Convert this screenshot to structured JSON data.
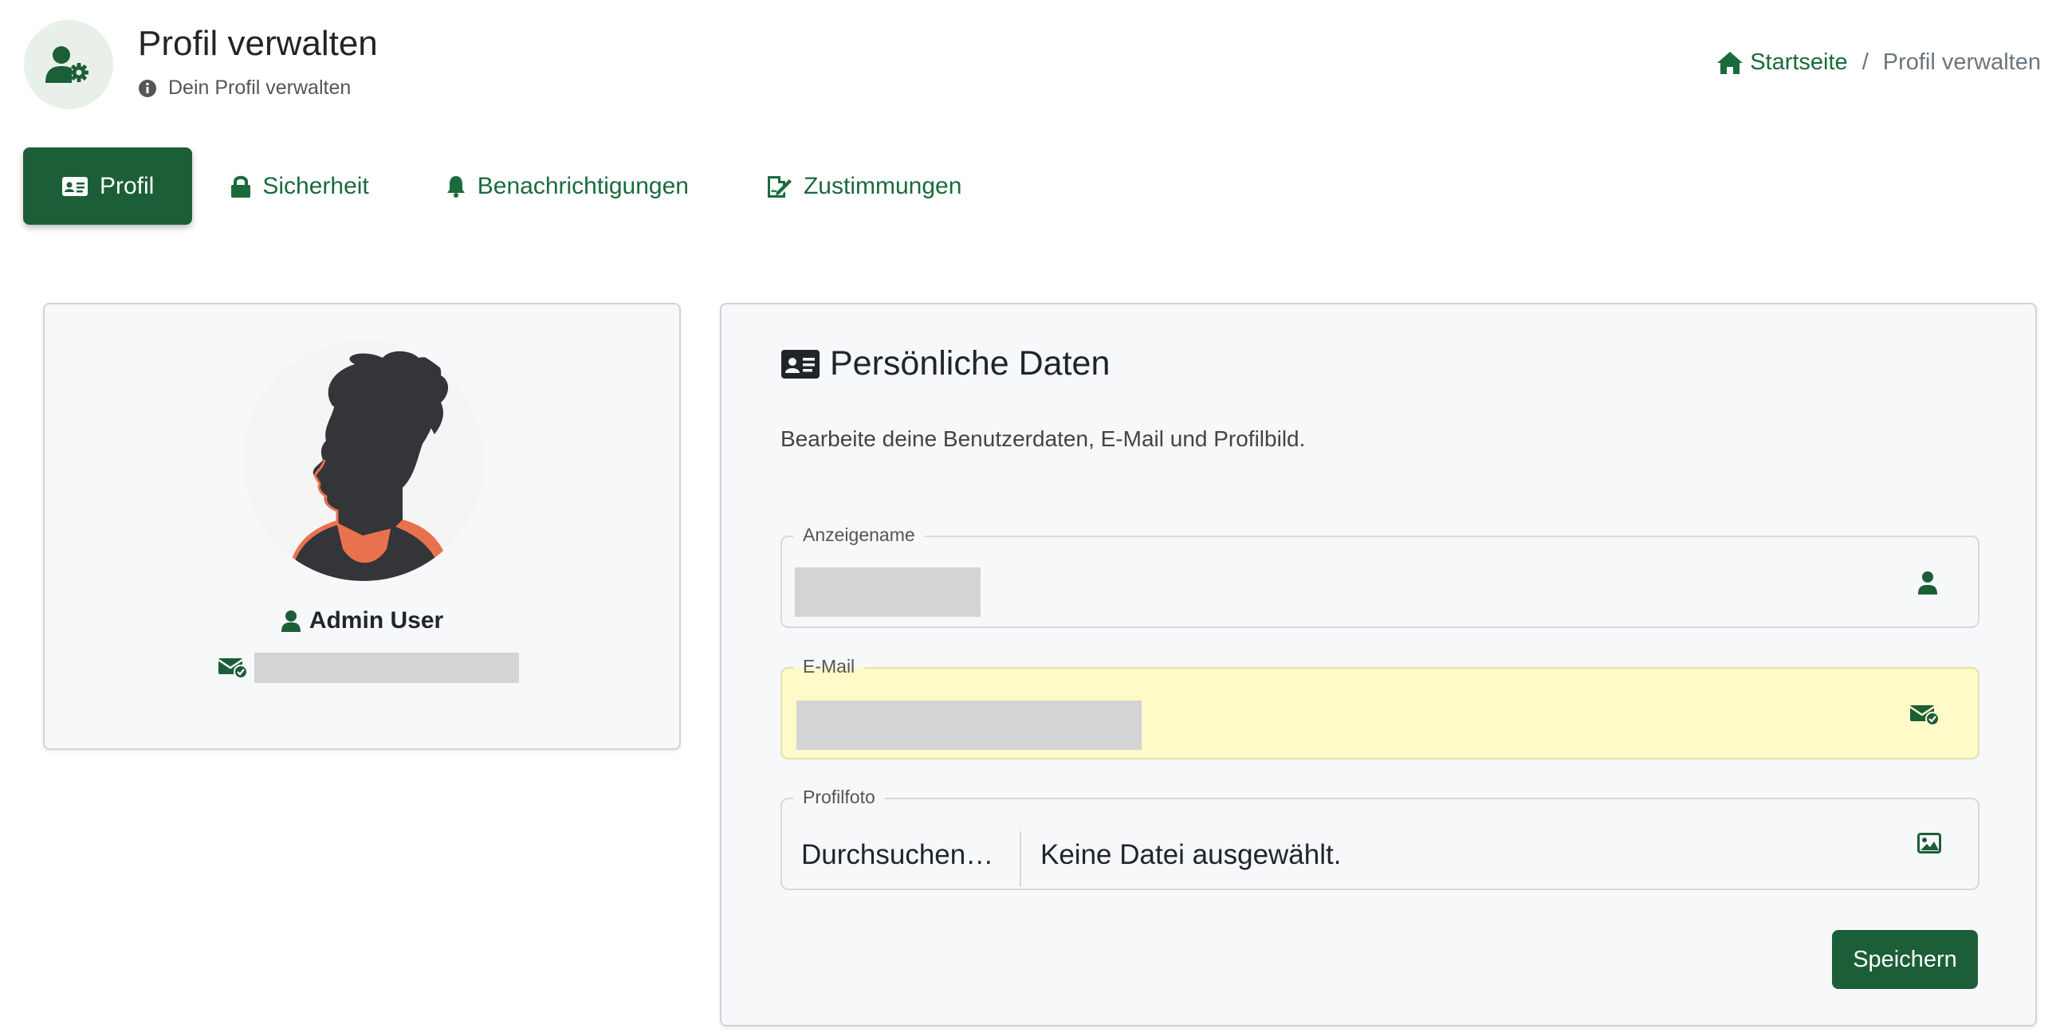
{
  "header": {
    "title": "Profil verwalten",
    "subtitle": "Dein Profil verwalten",
    "icon": "user-gear-icon"
  },
  "breadcrumb": {
    "home_label": "Startseite",
    "separator": "/",
    "current": "Profil verwalten"
  },
  "tabs": [
    {
      "label": "Profil",
      "icon": "id-card-icon",
      "active": true
    },
    {
      "label": "Sicherheit",
      "icon": "lock-icon",
      "active": false
    },
    {
      "label": "Benachrichtigungen",
      "icon": "bell-icon",
      "active": false
    },
    {
      "label": "Zustimmungen",
      "icon": "signature-icon",
      "active": false
    }
  ],
  "profile_card": {
    "name": "Admin User",
    "avatar": "avatar-silhouette"
  },
  "personal_data": {
    "title": "Persönliche Daten",
    "description": "Bearbeite deine Benutzerdaten, E-Mail und Profilbild.",
    "fields": {
      "display_name": {
        "label": "Anzeigename"
      },
      "email": {
        "label": "E-Mail"
      },
      "photo": {
        "label": "Profilfoto",
        "browse_label": "Durchsuchen…",
        "no_file": "Keine Datei ausgewählt."
      }
    },
    "save_label": "Speichern"
  },
  "colors": {
    "primary": "#1c5e37",
    "link": "#1a6b3c",
    "highlight": "#fffac8"
  }
}
